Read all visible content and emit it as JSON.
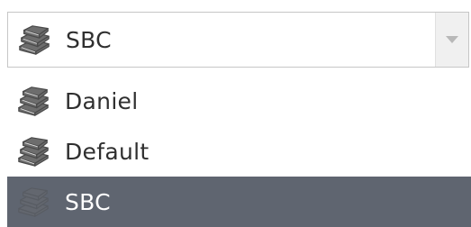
{
  "dropdown": {
    "selected_label": "SBC",
    "selected_icon": "book-stack-icon",
    "arrow_icon": "chevron-down-icon",
    "options": [
      {
        "label": "Daniel",
        "icon": "book-stack-icon",
        "selected": false
      },
      {
        "label": "Default",
        "icon": "book-stack-icon",
        "selected": false
      },
      {
        "label": "SBC",
        "icon": "book-stack-icon",
        "selected": true
      }
    ]
  },
  "colors": {
    "highlight_background": "#5f6570",
    "text": "#2f2f2f",
    "icon_fill": "#6d6d6d"
  }
}
